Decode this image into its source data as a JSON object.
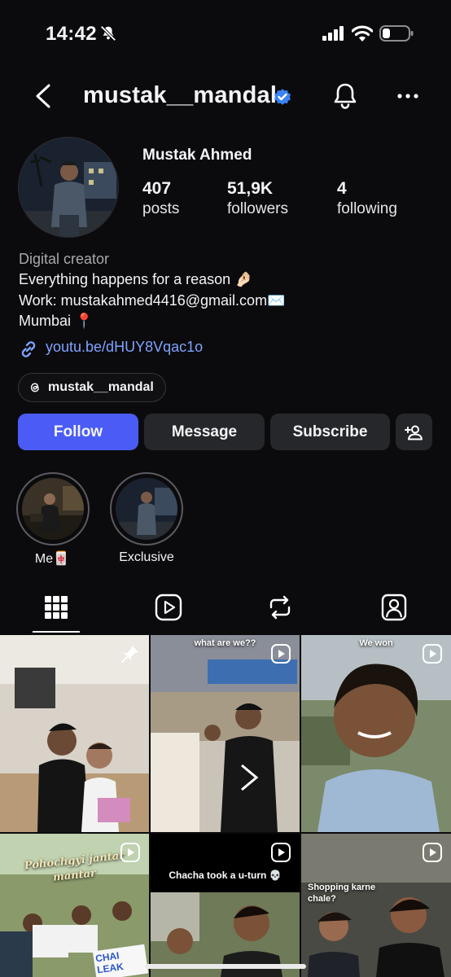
{
  "status_bar": {
    "time": "14:42"
  },
  "header": {
    "username": "mustak__mandal"
  },
  "profile": {
    "display_name": "Mustak Ahmed",
    "stats": [
      {
        "value": "407",
        "label": "posts"
      },
      {
        "value": "51,9K",
        "label": "followers"
      },
      {
        "value": "4",
        "label": "following"
      }
    ],
    "bio": {
      "category": "Digital creator",
      "lines": [
        "Everything happens for a reason 🤌🏻",
        "Work: mustakahmed4416@gmail.com✉️",
        "Mumbai 📍"
      ],
      "link": "youtu.be/dHUY8Vqac1o"
    },
    "threads_handle": "mustak__mandal"
  },
  "actions": {
    "follow": "Follow",
    "message": "Message",
    "subscribe": "Subscribe"
  },
  "highlights": [
    {
      "label": "Me🀄"
    },
    {
      "label": "Exclusive"
    }
  ],
  "tabs": [
    "grid-icon",
    "reels-icon",
    "reposts-icon",
    "tagged-icon"
  ],
  "grid": {
    "captions": {
      "post2": "what are we??",
      "post3": "We won",
      "post4_line1": "Pohochgyi jantar",
      "post4_line2": "mantar",
      "post4_sign": "CHAI LEAK",
      "post5": "Chacha took a u-turn 💀",
      "post6_line1": "Shopping karne",
      "post6_line2": "chale?"
    }
  },
  "colors": {
    "background": "#0b0b0d",
    "accent": "#4a5cf5",
    "link": "#7fa2ff",
    "verified": "#3b82f6"
  }
}
